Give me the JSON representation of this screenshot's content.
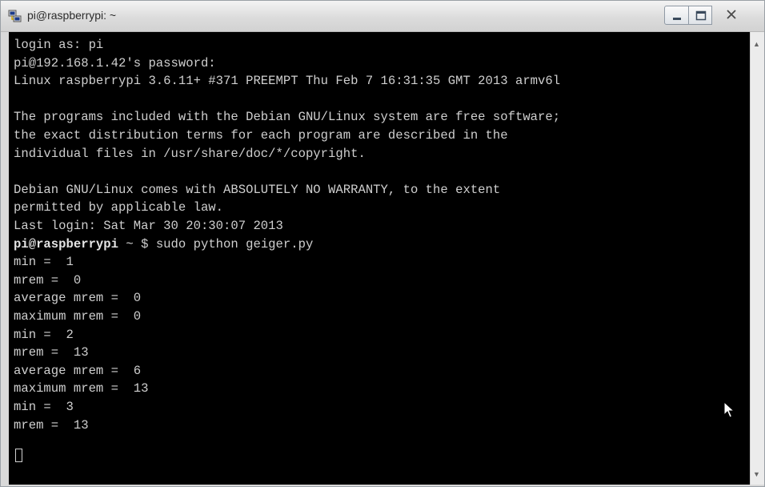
{
  "window": {
    "title": "pi@raspberrypi: ~",
    "icons": {
      "app": "putty-icon",
      "minimize": "minimize-icon",
      "maximize": "maximize-icon",
      "close": "close-icon"
    }
  },
  "terminal": {
    "lines": [
      "login as: pi",
      "pi@192.168.1.42's password:",
      "Linux raspberrypi 3.6.11+ #371 PREEMPT Thu Feb 7 16:31:35 GMT 2013 armv6l",
      "",
      "The programs included with the Debian GNU/Linux system are free software;",
      "the exact distribution terms for each program are described in the",
      "individual files in /usr/share/doc/*/copyright.",
      "",
      "Debian GNU/Linux comes with ABSOLUTELY NO WARRANTY, to the extent",
      "permitted by applicable law.",
      "Last login: Sat Mar 30 20:30:07 2013",
      "pi@raspberrypi ~ $ sudo python geiger.py",
      "min =  1",
      "mrem =  0",
      "average mrem =  0",
      "maximum mrem =  0",
      "min =  2",
      "mrem =  13",
      "average mrem =  6",
      "maximum mrem =  13",
      "min =  3",
      "mrem =  13"
    ],
    "prompt": {
      "user_host": "pi@raspberrypi",
      "path": "~ $",
      "command": "sudo python geiger.py"
    }
  },
  "colors": {
    "terminal_bg": "#000000",
    "terminal_fg": "#cfcfcf"
  }
}
